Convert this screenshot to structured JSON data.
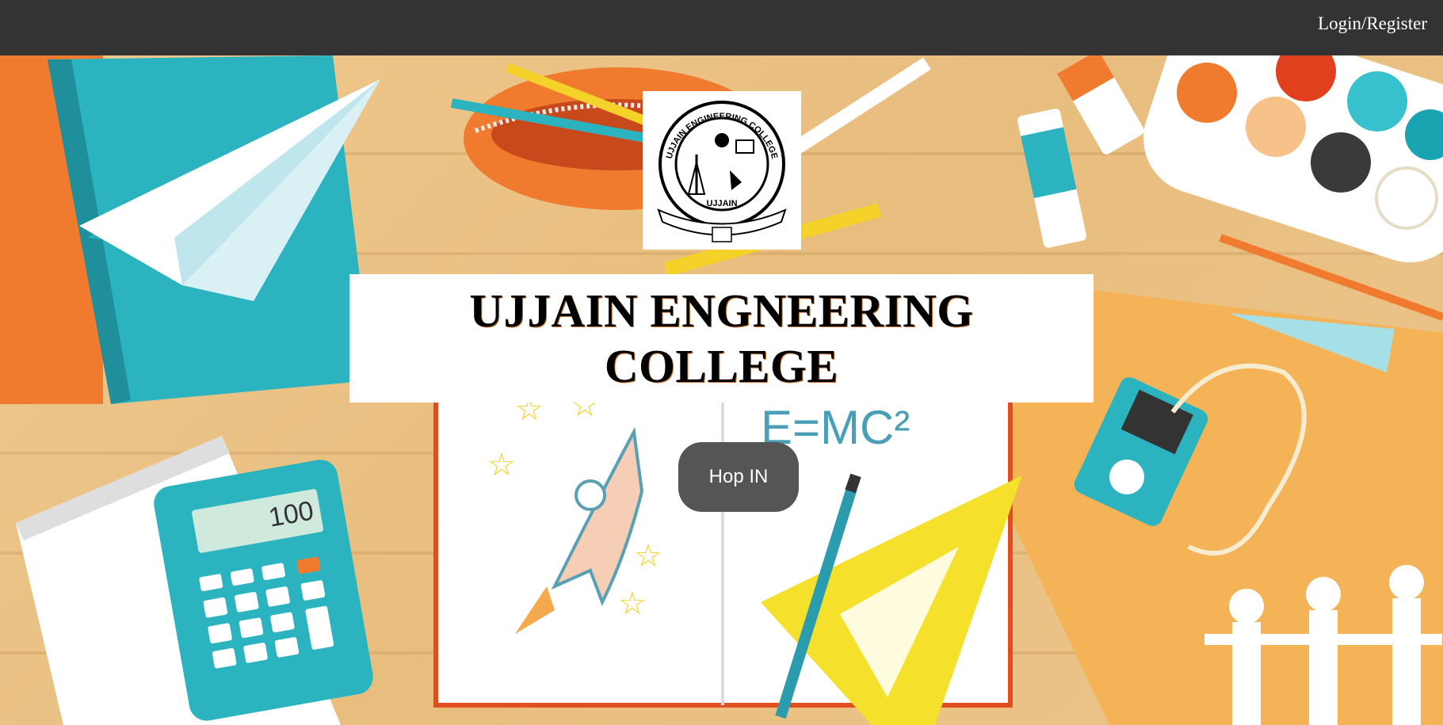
{
  "nav": {
    "login_label": "Login/Register"
  },
  "logo": {
    "text_top": "UJJAIN ENGINEERING COLLEGE",
    "text_bottom": "UJJAIN"
  },
  "hero": {
    "title": "UJJAIN ENGNEERING COLLEGE",
    "button_label": "Hop IN",
    "calculator_display": "100",
    "notebook_formula": "E=MC²"
  },
  "colors": {
    "topbar": "#333333",
    "button": "#555555",
    "accent_teal": "#2bb3c0",
    "accent_orange": "#f07a2e"
  }
}
